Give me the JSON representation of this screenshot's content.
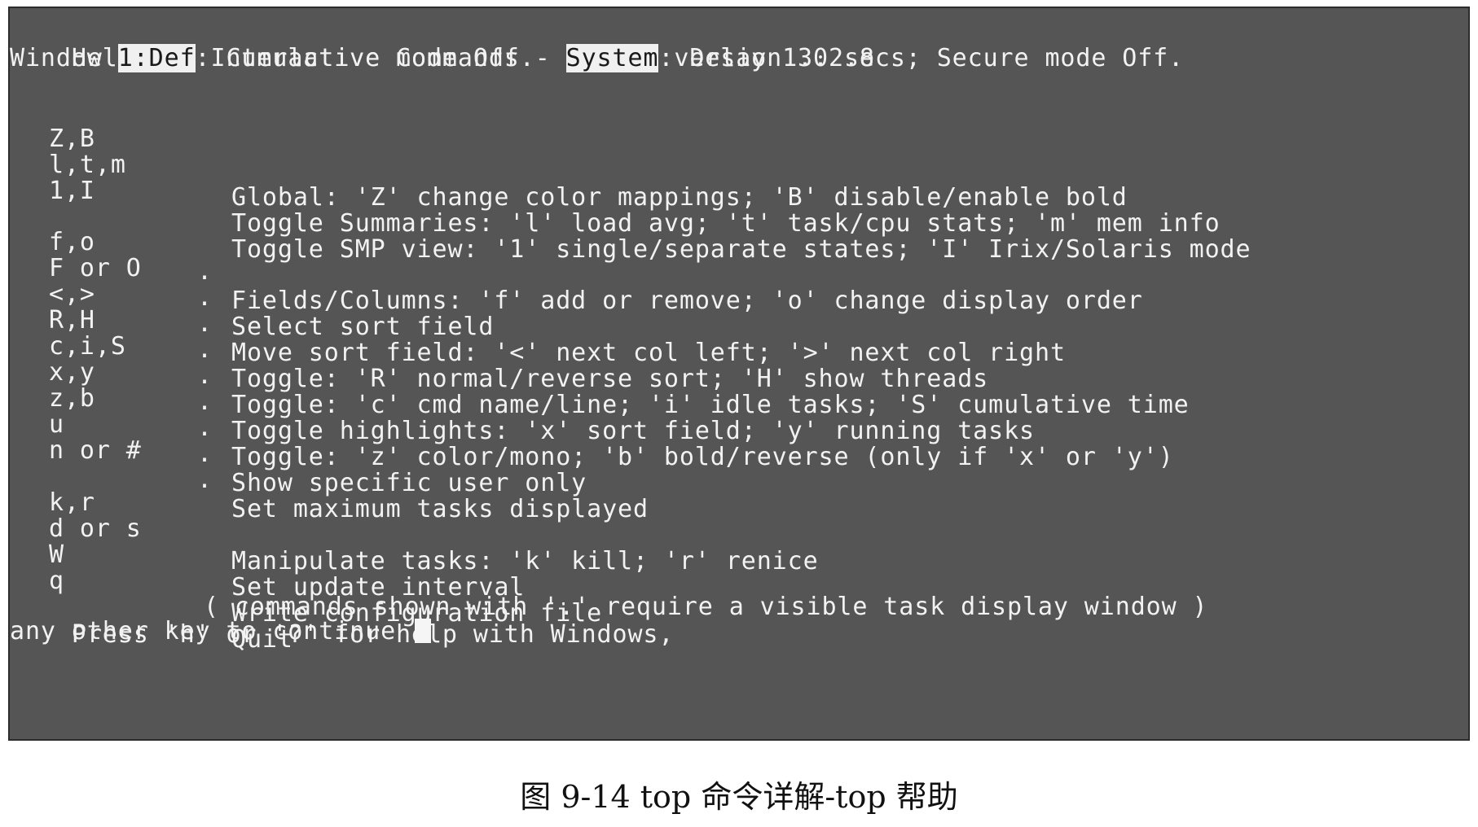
{
  "header": {
    "title": "Help for Interactive Commands - procps version 3.2.8",
    "window_prefix": "Window ",
    "window_name": "1:Def",
    "window_status": ": Cumulative mode Off.  ",
    "system_label": "System",
    "system_status": ": Delay 1.0 secs; Secure mode Off."
  },
  "commands": [
    {
      "key": "Z,B",
      "dot": "",
      "desc": "Global: 'Z' change color mappings; 'B' disable/enable bold"
    },
    {
      "key": "l,t,m",
      "dot": "",
      "desc": "Toggle Summaries: 'l' load avg; 't' task/cpu stats; 'm' mem info"
    },
    {
      "key": "1,I",
      "dot": "",
      "desc": "Toggle SMP view: '1' single/separate states; 'I' Irix/Solaris mode"
    },
    {
      "key": "f,o",
      "dot": ".",
      "desc": "Fields/Columns: 'f' add or remove; 'o' change display order"
    },
    {
      "key": "F or O",
      "dot": ".",
      "desc": "Select sort field"
    },
    {
      "key": "<,>",
      "dot": ".",
      "desc": "Move sort field: '<' next col left; '>' next col right"
    },
    {
      "key": "R,H",
      "dot": ".",
      "desc": "Toggle: 'R' normal/reverse sort; 'H' show threads"
    },
    {
      "key": "c,i,S",
      "dot": ".",
      "desc": "Toggle: 'c' cmd name/line; 'i' idle tasks; 'S' cumulative time"
    },
    {
      "key": "x,y",
      "dot": ".",
      "desc": "Toggle highlights: 'x' sort field; 'y' running tasks"
    },
    {
      "key": "z,b",
      "dot": ".",
      "desc": "Toggle: 'z' color/mono; 'b' bold/reverse (only if 'x' or 'y')"
    },
    {
      "key": "u",
      "dot": ".",
      "desc": "Show specific user only"
    },
    {
      "key": "n or #",
      "dot": ".",
      "desc": "Set maximum tasks displayed"
    },
    {
      "key": "k,r",
      "dot": "",
      "desc": "Manipulate tasks: 'k' kill; 'r' renice"
    },
    {
      "key": "d or s",
      "dot": "",
      "desc": "Set update interval"
    },
    {
      "key": "W",
      "dot": "",
      "desc": "Write configuration file"
    },
    {
      "key": "q",
      "dot": "",
      "desc": "Quit"
    }
  ],
  "footer": {
    "note": "( commands shown with '.' require a visible task display window )",
    "press_line": "Press 'h' or '?' for help with Windows,",
    "continue_line": "any other key to continue "
  },
  "caption": "图 9-14    top 命令详解-top 帮助",
  "colors": {
    "terminal_bg": "#555555",
    "terminal_text": "#f2f2f2",
    "highlight_bg": "#f0f0f0",
    "highlight_text": "#1a1a1a"
  }
}
